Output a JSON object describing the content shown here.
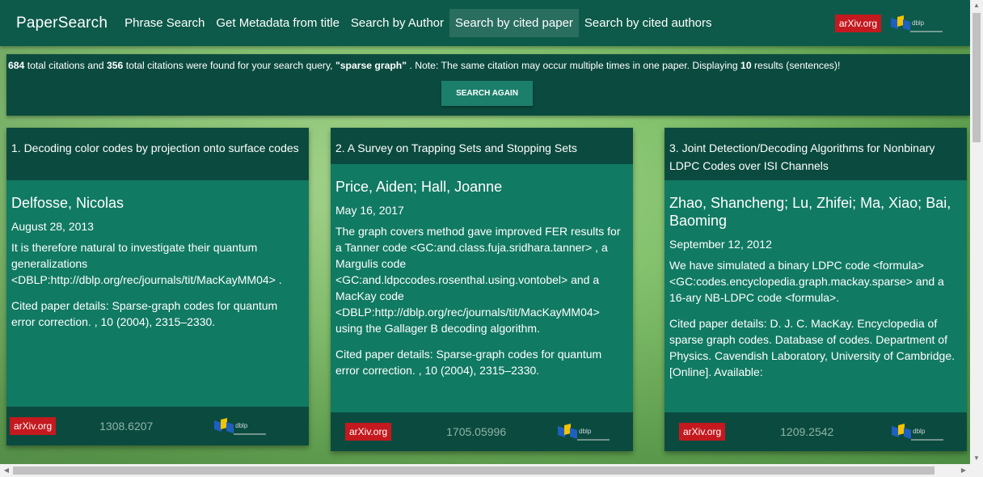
{
  "nav": {
    "brand": "PaperSearch",
    "items": [
      {
        "label": "Phrase Search",
        "active": false
      },
      {
        "label": "Get Metadata from title",
        "active": false
      },
      {
        "label": "Search by Author",
        "active": false
      },
      {
        "label": "Search by cited paper",
        "active": true
      },
      {
        "label": "Search by cited authors",
        "active": false
      }
    ],
    "arxiv_label": "arXiv.org",
    "dblp_label": "dblp"
  },
  "info": {
    "citations_count": "684",
    "text1": " total citations and ",
    "papers_count": "356",
    "text2": " total citations were found for your search query, ",
    "query": "\"sparse graph\"",
    "text3": " . Note: The same citation may occur multiple times in one paper. Displaying ",
    "display_count": "10",
    "text4": " results (sentences)!",
    "search_again": "SEARCH AGAIN"
  },
  "cards": [
    {
      "title": "1. Decoding color codes by projection onto surface codes",
      "authors": "Delfosse, Nicolas",
      "date": "August 28, 2013",
      "sentence": "It is therefore natural to investigate their quantum generalizations <DBLP:http://dblp.org/rec/journals/tit/MacKayMM04> .",
      "details": "Cited paper details: Sparse-graph codes for quantum error correction. , 10 (2004), 2315–2330.",
      "arxiv_label": "arXiv.org",
      "arxiv_id": "1308.6207",
      "dblp_label": "dblp"
    },
    {
      "title": "2. A Survey on Trapping Sets and Stopping Sets",
      "authors": "Price, Aiden; Hall, Joanne",
      "date": "May 16, 2017",
      "sentence": "The graph covers method gave improved FER results for a Tanner code <GC:and.class.fuja.sridhara.tanner> , a Margulis code <GC:and.ldpccodes.rosenthal.using.vontobel> and a MacKay code <DBLP:http://dblp.org/rec/journals/tit/MacKayMM04> using the Gallager B decoding algorithm.",
      "details": "Cited paper details: Sparse-graph codes for quantum error correction. , 10 (2004), 2315–2330.",
      "arxiv_label": "arXiv.org",
      "arxiv_id": "1705.05996",
      "dblp_label": "dblp"
    },
    {
      "title": "3. Joint Detection/Decoding Algorithms for Nonbinary LDPC Codes over ISI Channels",
      "authors": "Zhao, Shancheng; Lu, Zhifei; Ma, Xiao; Bai, Baoming",
      "date": "September 12, 2012",
      "sentence": "We have simulated a binary LDPC code <formula> <GC:codes.encyclopedia.graph.mackay.sparse> and a 16-ary NB-LDPC code <formula>.",
      "details": "Cited paper details: D. J. C. MacKay. Encyclopedia of sparse graph codes. Database of codes. Department of Physics. Cavendish Laboratory, University of Cambridge. [Online]. Available:",
      "arxiv_label": "arXiv.org",
      "arxiv_id": "1209.2542",
      "dblp_label": "dblp"
    }
  ]
}
